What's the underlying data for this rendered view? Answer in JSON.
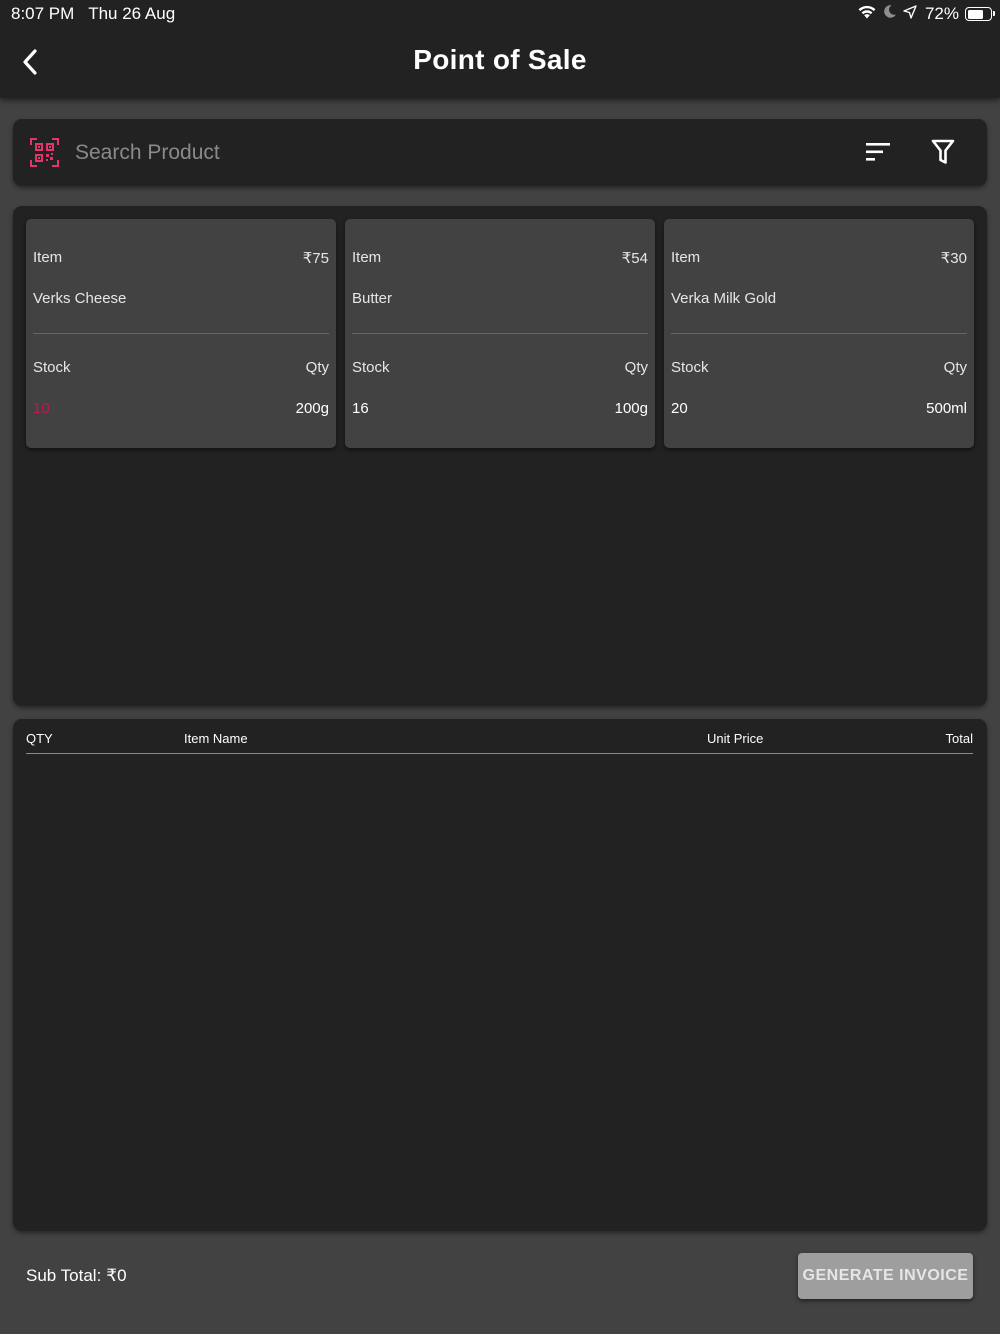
{
  "status_bar": {
    "time": "8:07 PM",
    "date": "Thu 26 Aug",
    "battery_percent": "72%",
    "battery_level": 0.72,
    "icons": [
      "wifi-icon",
      "moon-icon",
      "location-arrow-icon",
      "battery-icon"
    ]
  },
  "app_bar": {
    "title": "Point of Sale",
    "back_icon": "chevron-left-icon"
  },
  "search": {
    "placeholder": "Search Product",
    "value": "",
    "scan_icon": "qr-scan-icon",
    "sort_icon": "sort-icon",
    "filter_icon": "filter-icon"
  },
  "colors": {
    "background": "#424242",
    "surface": "#222222",
    "card": "#424242",
    "accent": "#e5336b",
    "low_stock": "#c2184d",
    "button_disabled": "#9e9e9e"
  },
  "products": [
    {
      "item_label": "Item",
      "price": "₹75",
      "name": "Verks Cheese",
      "stock_label": "Stock",
      "qty_label": "Qty",
      "stock": "10",
      "qty": "200g",
      "low_stock": true
    },
    {
      "item_label": "Item",
      "price": "₹54",
      "name": "Butter",
      "stock_label": "Stock",
      "qty_label": "Qty",
      "stock": "16",
      "qty": "100g",
      "low_stock": false
    },
    {
      "item_label": "Item",
      "price": "₹30",
      "name": "Verka Milk Gold",
      "stock_label": "Stock",
      "qty_label": "Qty",
      "stock": "20",
      "qty": "500ml",
      "low_stock": false
    }
  ],
  "order_table": {
    "columns": [
      "QTY",
      "Item Name",
      "Unit Price",
      "Total"
    ],
    "rows": []
  },
  "footer": {
    "subtotal_label": "Sub Total:",
    "subtotal_value": "₹0",
    "generate_invoice_label": "GENERATE INVOICE"
  }
}
